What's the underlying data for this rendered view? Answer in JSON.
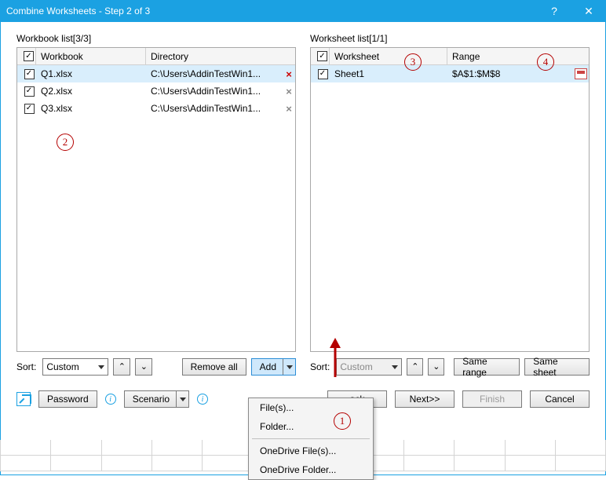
{
  "title": "Combine Worksheets - Step 2 of 3",
  "left": {
    "label": "Workbook list[3/3]",
    "columns": {
      "workbook": "Workbook",
      "directory": "Directory"
    },
    "rows": [
      {
        "checked": true,
        "name": "Q1.xlsx",
        "dir": "C:\\Users\\AddinTestWin1...",
        "selected": true,
        "remove": "red"
      },
      {
        "checked": true,
        "name": "Q2.xlsx",
        "dir": "C:\\Users\\AddinTestWin1...",
        "selected": false,
        "remove": "gray"
      },
      {
        "checked": true,
        "name": "Q3.xlsx",
        "dir": "C:\\Users\\AddinTestWin1...",
        "selected": false,
        "remove": "gray"
      }
    ],
    "sort_label": "Sort:",
    "sort_value": "Custom",
    "remove_all": "Remove all",
    "add": "Add"
  },
  "right": {
    "label": "Worksheet list[1/1]",
    "columns": {
      "worksheet": "Worksheet",
      "range": "Range"
    },
    "rows": [
      {
        "checked": true,
        "name": "Sheet1",
        "range": "$A$1:$M$8",
        "selected": true
      }
    ],
    "sort_label": "Sort:",
    "sort_value": "Custom",
    "same_range": "Same range",
    "same_sheet": "Same sheet"
  },
  "menu": {
    "files": "File(s)...",
    "folder": "Folder...",
    "onedrive_files": "OneDrive File(s)...",
    "onedrive_folder": "OneDrive Folder..."
  },
  "bottom": {
    "password": "Password",
    "scenario": "Scenario",
    "back": "ack",
    "next": "Next>>",
    "finish": "Finish",
    "cancel": "Cancel"
  },
  "anno": {
    "a1": "1",
    "a2": "2",
    "a3": "3",
    "a4": "4"
  },
  "help": "?",
  "close": "✕"
}
